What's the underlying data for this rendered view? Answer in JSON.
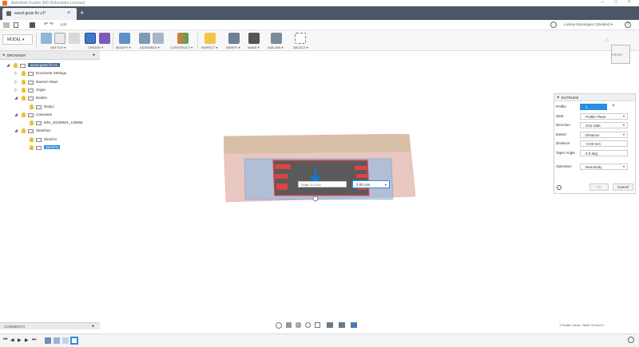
{
  "app": {
    "window_title": "Autodesk Fusion 360 (Education License)"
  },
  "tab": {
    "label": "wood grain fix v1*"
  },
  "qat": {
    "undo_redo": "↶ ↷",
    "label": "jrolt",
    "user": "Lorena Dominguez (Student) ▾",
    "help": "?"
  },
  "toolbar": {
    "model": "MODEL ▾",
    "groups": [
      "SKETCH ▾",
      "CREATE ▾",
      "MODIFY ▾",
      "ASSEMBLE ▾",
      "CONSTRUCT ▾",
      "INSPECT ▾",
      "INSERT ▾",
      "MAKE ▾",
      "ADD-INS ▾",
      "SELECT ▾"
    ]
  },
  "browser": {
    "header": "BROWSER",
    "items": [
      {
        "label": "wood grain fix v1",
        "arrow": "◢",
        "level": 0,
        "selected": true
      },
      {
        "label": "Document Settings",
        "arrow": "▷",
        "level": 1
      },
      {
        "label": "Named Views",
        "arrow": "▷",
        "level": 1
      },
      {
        "label": "Origin",
        "arrow": "▷",
        "level": 1
      },
      {
        "label": "Bodies",
        "arrow": "◢",
        "level": 1
      },
      {
        "label": "Body1",
        "arrow": "",
        "level": 2
      },
      {
        "label": "Canvases",
        "arrow": "◢",
        "level": 1
      },
      {
        "label": "IMG_20190501_135656",
        "arrow": "",
        "level": 2
      },
      {
        "label": "Sketches",
        "arrow": "◢",
        "level": 1
      },
      {
        "label": "Sketch1",
        "arrow": "",
        "level": 2
      },
      {
        "label": "Sketch2",
        "arrow": "",
        "level": 2,
        "highlight": true
      }
    ]
  },
  "extrude": {
    "title": "EXTRUDE",
    "rows": [
      {
        "label": "Profile",
        "value": "1 selected",
        "type": "chip"
      },
      {
        "label": "Start",
        "value": "Profile Plane",
        "type": "select"
      },
      {
        "label": "Direction",
        "value": "One Side",
        "type": "select"
      },
      {
        "label": "Extent",
        "value": "Distance",
        "type": "select"
      },
      {
        "label": "Distance",
        "value": "-0.00 mm",
        "type": "field"
      },
      {
        "label": "Taper Angle",
        "value": "0.0 deg",
        "type": "field"
      },
      {
        "label": "Operation",
        "value": "New Body",
        "type": "select"
      }
    ],
    "ok": "OK",
    "cancel": "Cancel"
  },
  "viewport": {
    "distance_input": "0.00 mm",
    "tooltip": "Snap To: 0.00"
  },
  "viewcube": {
    "label": "FRONT"
  },
  "comments": {
    "label": "COMMENTS"
  },
  "status": {
    "text": "1 Profile | Area : 5840.78 mm^2"
  },
  "colors": {
    "tabbar": "#4b5666",
    "accent": "#0696d7",
    "sketch_red": "#e0434a",
    "profile_blue": "#7fb3e6"
  }
}
